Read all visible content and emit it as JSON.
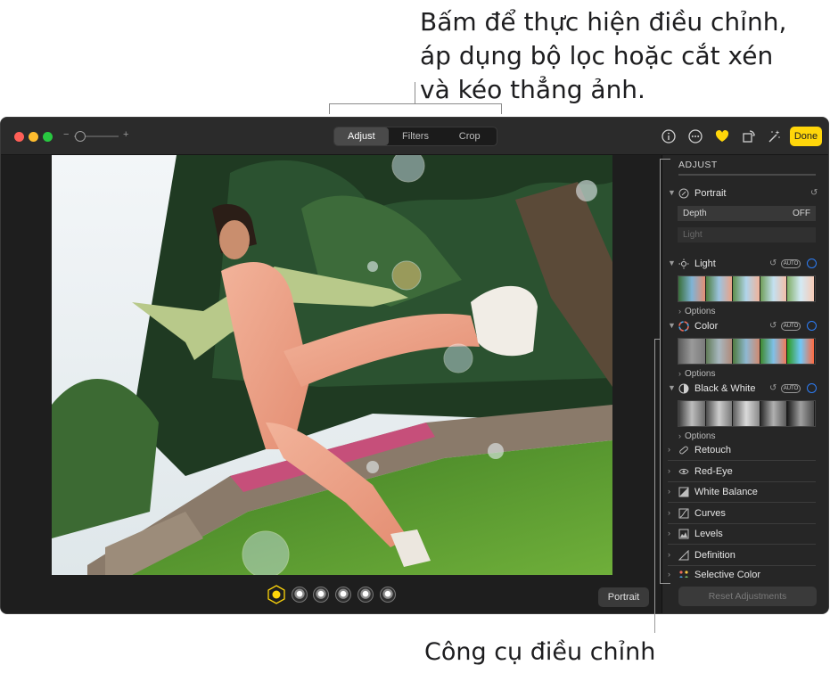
{
  "callouts": {
    "top_lines": [
      "Bấm để thực hiện điều chỉnh,",
      "áp dụng bộ lọc hoặc cắt xén",
      "và kéo thẳng ảnh."
    ],
    "bottom": "Công cụ điều chỉnh"
  },
  "toolbar": {
    "zoom_minus": "−",
    "zoom_plus": "+",
    "tabs": [
      {
        "label": "Adjust",
        "active": true
      },
      {
        "label": "Filters",
        "active": false
      },
      {
        "label": "Crop",
        "active": false
      }
    ],
    "icons": [
      "info-icon",
      "more-icon",
      "favorite-heart-icon",
      "rotate-icon",
      "auto-enhance-icon"
    ],
    "done_label": "Done",
    "accent": "#ffd60a"
  },
  "bottom_bar": {
    "portrait_label": "Portrait",
    "lighting_presets": 6
  },
  "sidebar": {
    "title": "ADJUST",
    "portrait": {
      "label": "Portrait",
      "depth_label": "Depth",
      "depth_value": "OFF",
      "light_label": "Light"
    },
    "light": {
      "label": "Light",
      "auto": "AUTO",
      "options": "Options"
    },
    "color": {
      "label": "Color",
      "auto": "AUTO",
      "options": "Options"
    },
    "bw": {
      "label": "Black & White",
      "auto": "AUTO",
      "options": "Options"
    },
    "rows": [
      {
        "label": "Retouch",
        "icon": "bandage-icon"
      },
      {
        "label": "Red-Eye",
        "icon": "eye-icon"
      },
      {
        "label": "White Balance",
        "icon": "white-balance-icon"
      },
      {
        "label": "Curves",
        "icon": "curves-icon"
      },
      {
        "label": "Levels",
        "icon": "levels-icon"
      },
      {
        "label": "Definition",
        "icon": "definition-icon"
      },
      {
        "label": "Selective Color",
        "icon": "selective-color-icon"
      }
    ],
    "reset_label": "Reset Adjustments"
  }
}
